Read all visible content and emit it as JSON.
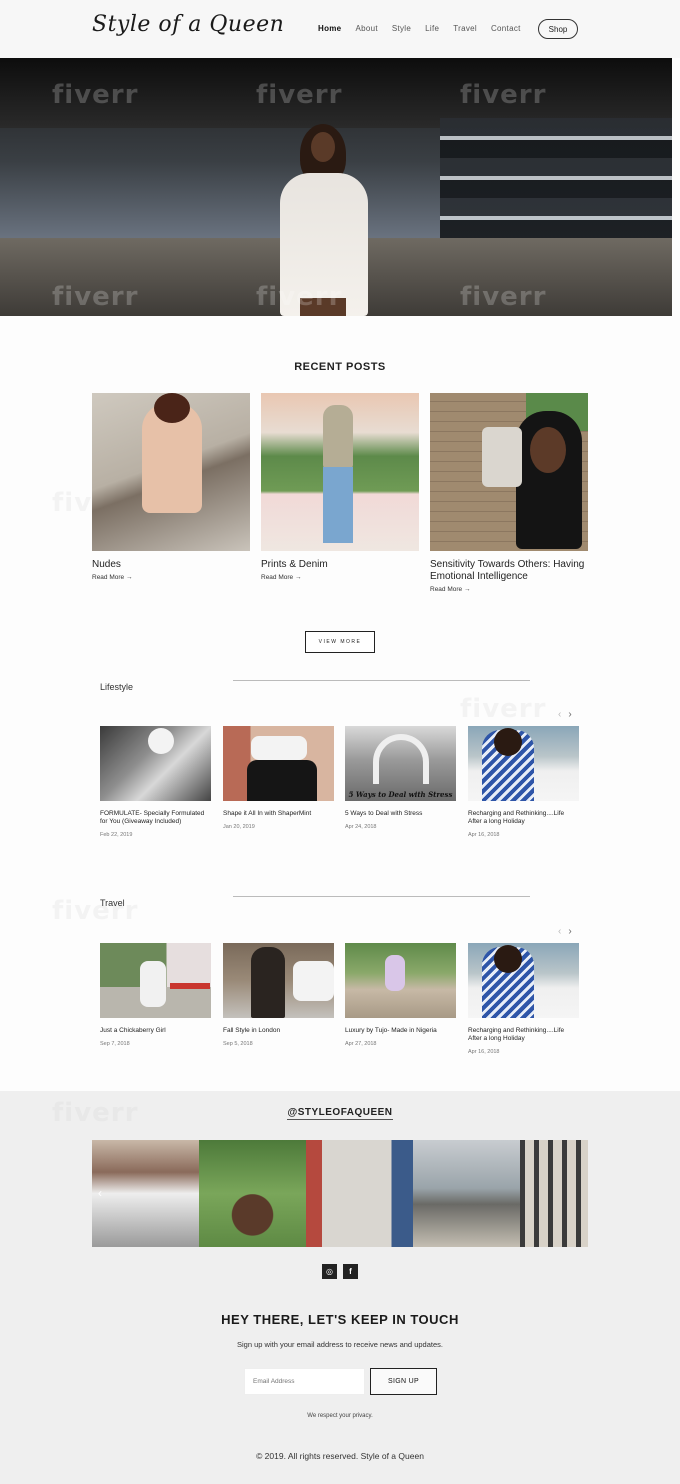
{
  "header": {
    "logo": "Style of a Queen",
    "nav": [
      "Home",
      "About",
      "Style",
      "Life",
      "Travel",
      "Contact"
    ],
    "shop_label": "Shop"
  },
  "watermark": "fiverr",
  "recent": {
    "title": "RECENT POSTS",
    "posts": [
      {
        "title": "Nudes",
        "more": "Read More →"
      },
      {
        "title": "Prints & Denim",
        "more": "Read More →"
      },
      {
        "title": "Sensitivity Towards Others: Having Emotional Intelligence",
        "more": "Read More →"
      }
    ],
    "view_more": "VIEW MORE"
  },
  "lifestyle": {
    "label": "Lifestyle",
    "cards": [
      {
        "title": "FORMULATE- Specially Formulated for You (Giveaway Included)",
        "date": "Feb 22, 2019"
      },
      {
        "title": "Shape it All In with ShaperMint",
        "date": "Jan 20, 2019"
      },
      {
        "title": "5 Ways to Deal with Stress",
        "date": "Apr 24, 2018",
        "overlay": "5 Ways to Deal with Stress"
      },
      {
        "title": "Recharging and Rethinking....Life After a long Holiday",
        "date": "Apr 16, 2018"
      }
    ]
  },
  "travel": {
    "label": "Travel",
    "cards": [
      {
        "title": "Just a Chickaberry Girl",
        "date": "Sep 7, 2018"
      },
      {
        "title": "Fall Style in London",
        "date": "Sep 5, 2018"
      },
      {
        "title": "Luxury by Tujo- Made in Nigeria",
        "date": "Apr 27, 2018"
      },
      {
        "title": "Recharging and Rethinking....Life After a long Holiday",
        "date": "Apr 16, 2018"
      }
    ]
  },
  "instagram": {
    "handle": "@STYLEOFAQUEEN"
  },
  "newsletter": {
    "title": "HEY THERE, LET'S KEEP IN TOUCH",
    "subtitle": "Sign up with your email address to receive news and updates.",
    "email_placeholder": "Email Address",
    "signup_label": "SIGN UP",
    "privacy": "We respect your privacy."
  },
  "footer": {
    "copyright": "© 2019. All rights reserved. Style of a Queen"
  }
}
